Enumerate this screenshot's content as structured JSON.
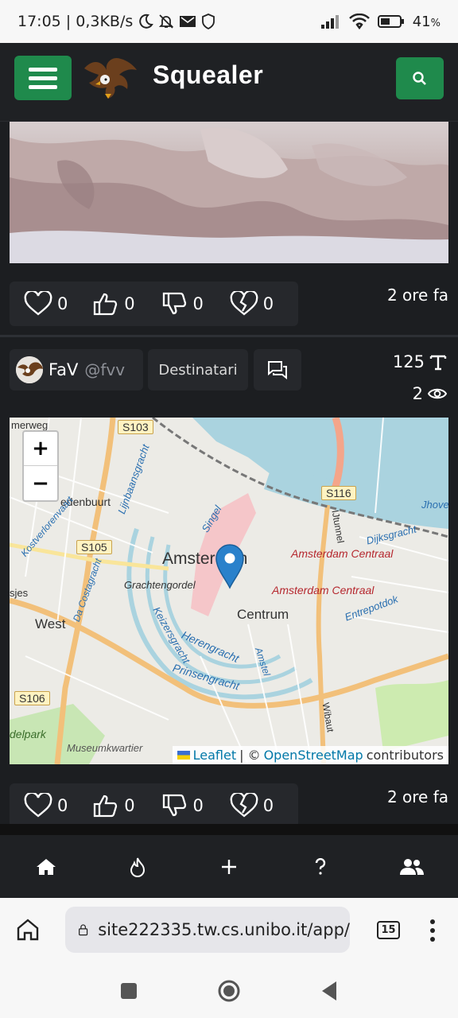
{
  "status_bar": {
    "time_speed": "17:05 | 0,3KB/s",
    "battery": "41",
    "battery_unit": "%"
  },
  "navbar": {
    "brand": "Squealer"
  },
  "posts": [
    {
      "reactions": {
        "hearts": "0",
        "likes": "0",
        "dislikes": "0",
        "broken_hearts": "0"
      },
      "time": "2 ore fa"
    },
    {
      "author_name": "FaV",
      "author_handle": "@fvv",
      "recipients_label": "Destinatari",
      "char_count": "125",
      "view_count": "2",
      "map": {
        "labels": {
          "amsterdam": "Amsterdam",
          "centrum": "Centrum",
          "west": "West",
          "centraal1": "Amsterdam Centraal",
          "centraal2": "Amsterdam Centraal",
          "grachtengordel": "Grachtengordel",
          "herengracht": "Herengracht",
          "prinsengracht": "Prinsengracht",
          "keizersgracht": "Keizersgracht",
          "singel": "Singel",
          "museumkwartier": "Museumkwartier",
          "edenbuurt": "edenbuurt",
          "delpark": "delpark",
          "jhoven": "Jhoven",
          "dijksgracht": "Dijksgracht",
          "entrepotdok": "Entrepotdok",
          "merweg": "merweg",
          "lijnbaansgracht": "Lijnbaansgracht",
          "kostverloren": "Kostverlorenvaart",
          "costagracht": "Da Costagracht",
          "amstel": "Amstel",
          "wibaut": "Wibaut",
          "ijtunnel": "IJtunnel",
          "sjes": "sjes"
        },
        "shields": {
          "s103": "S103",
          "s105": "S105",
          "s106": "S106",
          "s116": "S116"
        },
        "zoom_in": "+",
        "zoom_out": "−",
        "attribution": {
          "leaflet": "Leaflet",
          "sep": "| ©",
          "osm": "OpenStreetMap",
          "contributors": "contributors"
        }
      },
      "reactions": {
        "hearts": "0",
        "likes": "0",
        "dislikes": "0",
        "broken_hearts": "0"
      },
      "time": "2 ore fa"
    }
  ],
  "browser": {
    "url": "site222335.tw.cs.unibo.it/app/",
    "tab_count": "15"
  },
  "colors": {
    "accent": "#1f8a4c",
    "background": "#1c1e21"
  }
}
